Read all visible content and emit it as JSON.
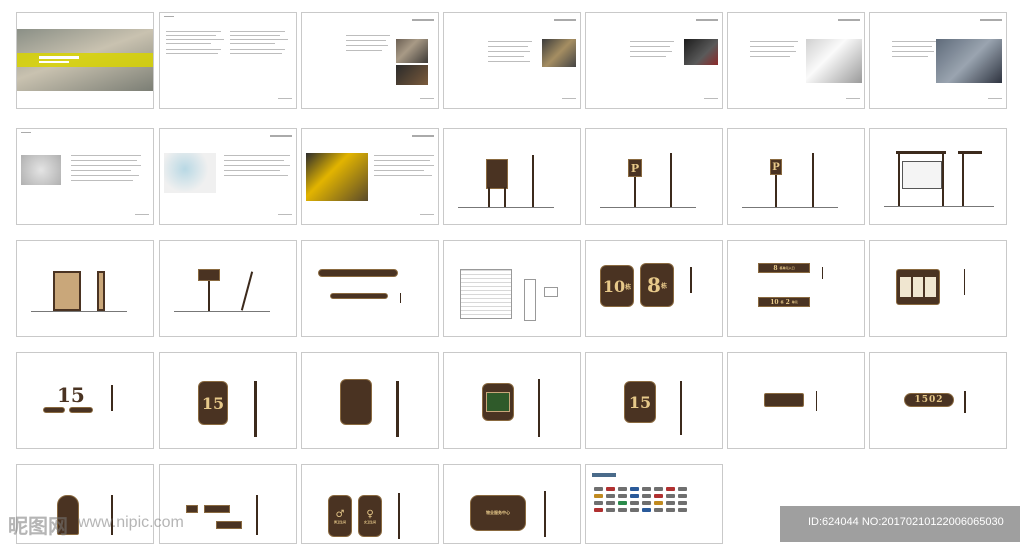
{
  "cover": {
    "title_lines": [
      "",
      ""
    ]
  },
  "signs": {
    "p_letter": "P",
    "bldg_10": "10",
    "bldg_10_unit": "栋",
    "bldg_8": "8",
    "bldg_8_unit": "栋",
    "unit_8": "8",
    "unit_8_text": "栋单元入口",
    "unit_10": "10",
    "unit_10_mid": "栋",
    "unit_2": "2",
    "unit_2_text": "单元",
    "num_15": "15",
    "room_1502": "1502",
    "wc_male": "男卫生间",
    "wc_female": "女卫生间",
    "club_text": "物业服务中心"
  },
  "watermark": {
    "left_brand": "昵图网",
    "left_url": "www.nipic.com",
    "right_id": "ID:624044 NO:20170210122006065030"
  }
}
